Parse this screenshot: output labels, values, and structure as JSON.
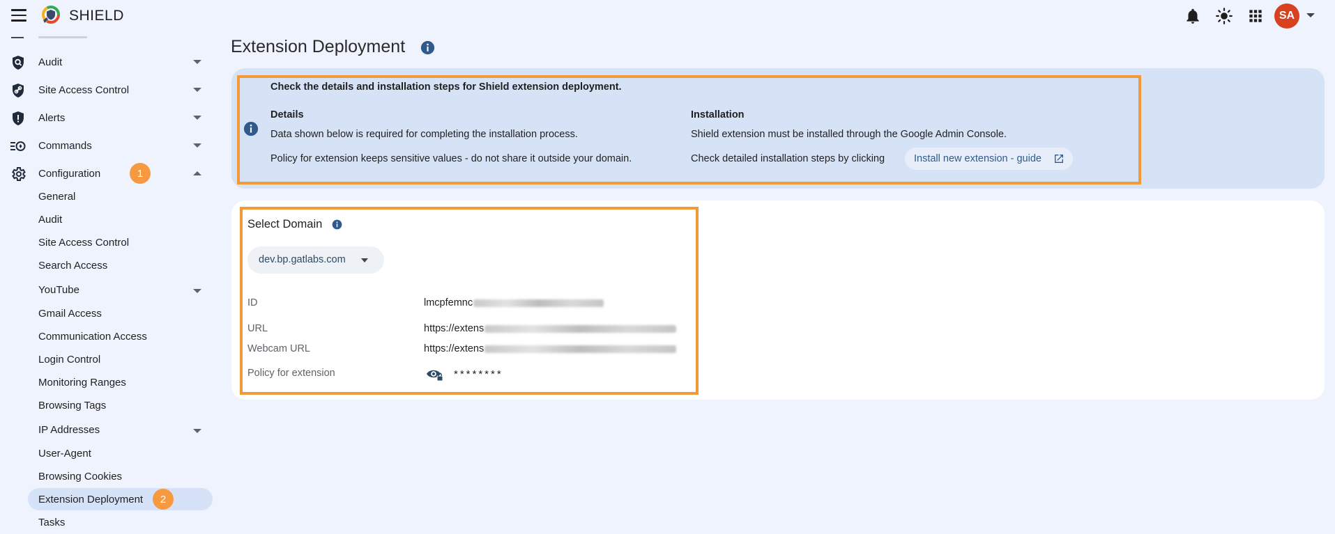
{
  "app": {
    "brand": "SHIELD"
  },
  "topbar": {
    "icons": [
      "bell-icon",
      "brightness-icon",
      "apps-grid-icon"
    ],
    "avatar_initials": "SA"
  },
  "sidebar": {
    "items": [
      {
        "label": "Audit",
        "icon": "magnifier-shield-icon",
        "expanded": false
      },
      {
        "label": "Site Access Control",
        "icon": "link-shield-icon",
        "expanded": false
      },
      {
        "label": "Alerts",
        "icon": "alert-shield-icon",
        "expanded": false
      },
      {
        "label": "Commands",
        "icon": "commands-icon",
        "expanded": false
      },
      {
        "label": "Configuration",
        "icon": "gear-icon",
        "expanded": true,
        "badge": "1"
      }
    ],
    "sub_items": [
      {
        "label": "General"
      },
      {
        "label": "Audit"
      },
      {
        "label": "Site Access Control"
      },
      {
        "label": "Search Access"
      },
      {
        "label": "YouTube",
        "has_children": true
      },
      {
        "label": "Gmail Access"
      },
      {
        "label": "Communication Access"
      },
      {
        "label": "Login Control"
      },
      {
        "label": "Monitoring Ranges"
      },
      {
        "label": "Browsing Tags"
      },
      {
        "label": "IP Addresses",
        "has_children": true
      },
      {
        "label": "User-Agent"
      },
      {
        "label": "Browsing Cookies"
      },
      {
        "label": "Extension Deployment",
        "selected": true,
        "badge": "2"
      },
      {
        "label": "Tasks"
      }
    ]
  },
  "main": {
    "title": "Extension Deployment",
    "info": {
      "intro": "Check the details and installation steps for Shield extension deployment.",
      "details_heading": "Details",
      "details_line1": "Data shown below is required for completing the installation process.",
      "details_line2": "Policy for extension keeps sensitive values - do not share it outside your domain.",
      "installation_heading": "Installation",
      "installation_line1": "Shield extension must be installed through the Google Admin Console.",
      "installation_line2": "Check detailed installation steps by clicking",
      "guide_button": "Install new extension - guide"
    },
    "domain": {
      "title": "Select Domain",
      "selected": "dev.bp.gatlabs.com",
      "fields": {
        "id_label": "ID",
        "id_value": "lmcpfemnc",
        "url_label": "URL",
        "url_value": "https://extens",
        "webcam_label": "Webcam URL",
        "webcam_value": "https://extens",
        "policy_label": "Policy for extension",
        "policy_value": "********"
      }
    }
  },
  "colors": {
    "accent_orange": "#f39a38",
    "badge_orange": "#f6993f",
    "avatar_red": "#d8401f",
    "info_blue": "#2f5a8b",
    "page_bg": "#eef3fd",
    "info_card_bg": "#d6e2f6"
  }
}
